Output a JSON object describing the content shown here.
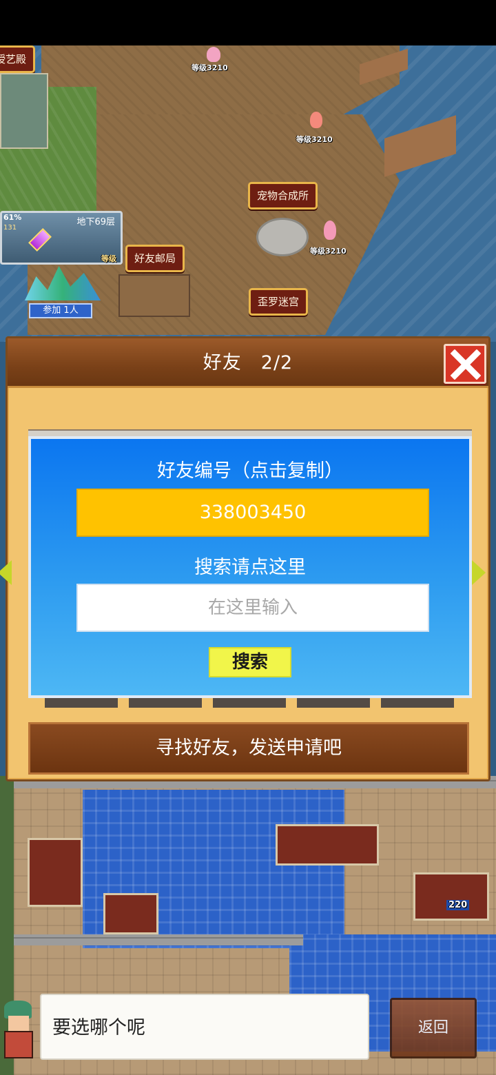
{
  "map_labels": {
    "top_left_building": "授艺殿",
    "pet_fusion": "宠物合成所",
    "friend_post": "好友邮局",
    "maze": "歪罗迷宫"
  },
  "level_tags": [
    "等级3210",
    "等级3210",
    "等级3210"
  ],
  "dungeon_card": {
    "title": "地下69层",
    "percent": "61%",
    "level": "131",
    "level_tag": "等级",
    "join_badge": "参加 1人"
  },
  "shop_counter": "220",
  "friend_dialog": {
    "title": "好友　2/2",
    "close_icon": "close-icon",
    "id_label": "好友编号（点击复制）",
    "friend_id": "338003450",
    "search_label": "搜索请点这里",
    "search_placeholder": "在这里输入",
    "search_button": "搜索",
    "hint": "寻找好友，发送申请吧"
  },
  "bottom_bar": {
    "speech": "要选哪个呢",
    "back_button": "返回"
  },
  "colors": {
    "dialog_header": "#7a4118",
    "panel_blue": "#0b76f0",
    "id_box_yellow": "#ffc200",
    "search_button": "#f1f54a",
    "close_red": "#d93626"
  }
}
